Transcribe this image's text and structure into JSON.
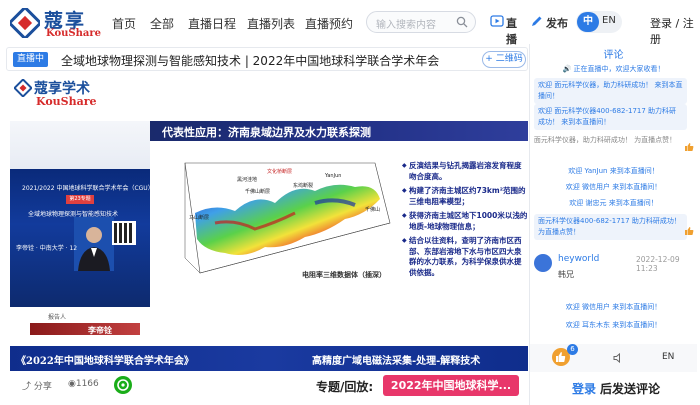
{
  "brand": {
    "name_cn": "蔻享",
    "name_en": "KouShare"
  },
  "nav": {
    "items": [
      "首页",
      "全部",
      "直播日程",
      "直播列表",
      "直播预约"
    ],
    "search_placeholder": "输入搜索内容",
    "live_btn": "直播",
    "publish_btn": "发布",
    "lang_zh": "中",
    "lang_en": "EN",
    "login": "登录 / 注册"
  },
  "titlebar": {
    "badge": "直播中",
    "title": "全域地球物理探测与智能感知技术 | 2022年中国地球科学联合学术年会",
    "qr_label": "二维码"
  },
  "video": {
    "slide_logo_cn": "蔻享学术",
    "slide_logo_en": "KouShare",
    "slide_title": "代表性应用：济南泉域边界及水力联系探测",
    "bullets": [
      "反演结果与钻孔揭露岩溶发育程度吻合度高。",
      "构建了济南主城区约73km²范围的三维电阻率模型；",
      "获得济南主城区地下1000米以浅的地质-地球物理信息；",
      "结合以往资料，查明了济南市区西部、东部岩溶地下水与市区四大泉群的水力联系，为科学保泉供水提供依据。"
    ],
    "map_caption": "电阻率三维数据体（插深）",
    "map_labels": [
      "黑河洼地",
      "文化桥断层",
      "千佛山断层",
      "东坞断裂",
      "马山断层",
      "YanJun",
      "千佛山"
    ],
    "poster_conf": "2021/2022 中国地球科学联合学术年会（CGU）",
    "poster_tag": "第23专题",
    "poster_sub": "全域地球物理探测与智能感知技术",
    "poster_speaker_line": "李帝铨 · 中南大学 · 12",
    "speaker_label": "报告人",
    "speaker_name": "李帝铨",
    "banner_left": "《2022年中国地球科学联合学术年会》",
    "banner_right": "高精度广域电磁法采集-处理-解释技术"
  },
  "bottombar": {
    "share": "分享",
    "views": "1166",
    "special_label": "专题/回放:",
    "special_value": "2022年中国地球科学..."
  },
  "comments": {
    "title": "评论",
    "welcome": "正在直播中，欢迎大家收看！",
    "msg1": "欢迎 面元科学仪器，助力科研成功！ 来到本直播间！",
    "msg2": "欢迎 面元科学仪器400-682-1717 助力科研成功！ 来到本直播间！",
    "msg3": "面元科学仪器，助力科研成功！ 为直播点赞！",
    "msg4": "欢迎 YanJun 来到本直播间！",
    "msg5": "欢迎 微信用户 来到本直播间！",
    "msg6": "欢迎 谢忠元 来到本直播间！",
    "msg7": "面元科学仪器400-682-1717 助力科研成功！ 为直播点赞！",
    "user_name": "heyworld",
    "user_time": "2022-12-09 11:23",
    "user_msg": "韩兄",
    "msg8": "欢迎 微信用户 来到本直播间！",
    "msg9": "欢迎 耳东木东 来到本直播间！",
    "like_count": "6",
    "footer_en": "EN",
    "login_btn": "登录",
    "login_txt": "后发送评论"
  },
  "colors": {
    "accent": "#2d7be5",
    "brand_blue": "#1b4f9c",
    "brand_red": "#d62b2b",
    "special_pink": "#e8376a"
  }
}
